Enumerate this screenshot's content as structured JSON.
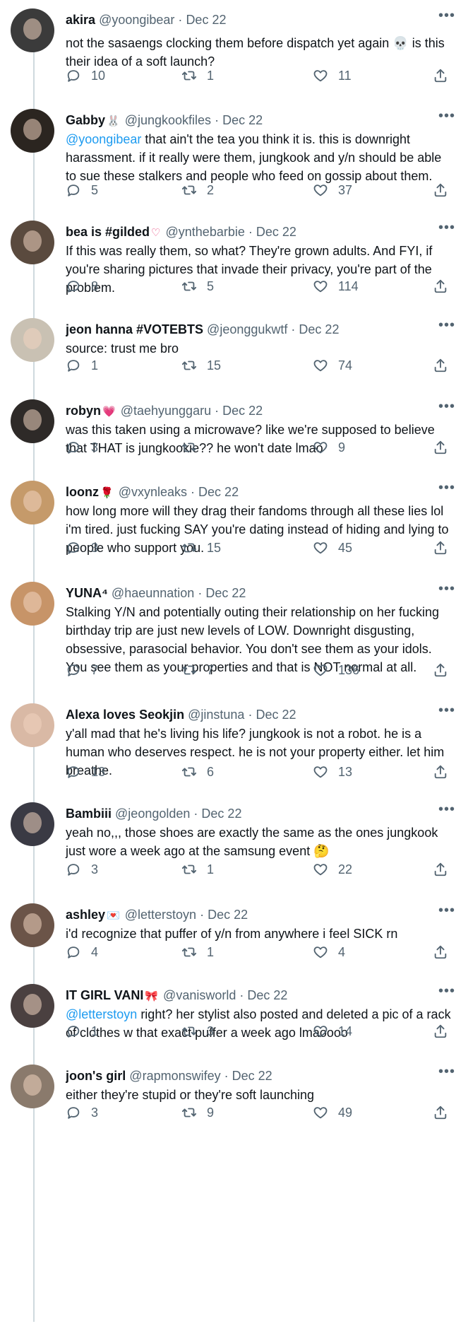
{
  "tweets": [
    {
      "name": "akira",
      "badge": "",
      "handle": "@yoongibear",
      "date": "Dec 22",
      "mention": "",
      "text": "not the sasaengs clocking them before dispatch yet again 💀 is this their idea of a soft launch?",
      "replies": "10",
      "retweets": "1",
      "likes": "11",
      "avatar_color": "#3b3b3b"
    },
    {
      "name": "Gabby",
      "badge": "🐰",
      "handle": "@jungkookfiles",
      "date": "Dec 22",
      "mention": "@yoongibear",
      "text": " that ain't the tea you think it is. this is downright harassment. if it really were them, jungkook and y/n should be able to sue these stalkers and people who feed on gossip about them.",
      "replies": "5",
      "retweets": "2",
      "likes": "37",
      "avatar_color": "#2b2520"
    },
    {
      "name": "bea is #gilded",
      "badge": "♡",
      "handle": "@ynthebarbie",
      "date": "Dec 22",
      "mention": "",
      "text": "If this was really them, so what? They're grown adults. And FYI, if you're sharing pictures that invade their privacy, you're part of the problem.",
      "replies": "8",
      "retweets": "5",
      "likes": "114",
      "avatar_color": "#5a4a3e"
    },
    {
      "name": "jeon hanna #VOTEBTS",
      "badge": "",
      "handle": "@jeonggukwtf",
      "date": "Dec 22",
      "mention": "",
      "text": "source: trust me bro",
      "replies": "1",
      "retweets": "15",
      "likes": "74",
      "avatar_color": "#c9c1b3"
    },
    {
      "name": "robyn",
      "badge": "💗",
      "handle": "@taehyunggaru",
      "date": "Dec 22",
      "mention": "",
      "text": "was this taken using a microwave? like we're supposed to believe that THAT is jungkookie?? he won't date lmao",
      "replies": "3",
      "retweets": "",
      "likes": "9",
      "avatar_color": "#2e2a28"
    },
    {
      "name": "loonz",
      "badge": "🌹",
      "handle": "@vxynleaks",
      "date": "Dec 22",
      "mention": "",
      "text": "how long more will they drag their fandoms through all these lies lol i'm tired. just fucking SAY you're dating instead of hiding and lying to people who support you.",
      "replies": "3",
      "retweets": "15",
      "likes": "45",
      "avatar_color": "#c59a6a"
    },
    {
      "name": "YUNA⁴",
      "badge": "",
      "handle": "@haeunnation",
      "date": "Dec 22",
      "mention": "",
      "text": "Stalking Y/N and potentially outing their relationship on her fucking birthday trip are just new levels of LOW. Downright disgusting, obsessive, parasocial behavior. You don't see them as your idols. You see them as your properties and that is NOT normal at all.",
      "replies": "7",
      "retweets": "7",
      "likes": "136",
      "avatar_color": "#c79468"
    },
    {
      "name": "Alexa loves Seokjin",
      "badge": "",
      "handle": "@jinstuna",
      "date": "Dec 22",
      "mention": "",
      "text": "y'all mad that he's living his life? jungkook is not a robot. he is a human who deserves respect. he is not your property either. let him breathe.",
      "replies": "13",
      "retweets": "6",
      "likes": "13",
      "avatar_color": "#d9b9a5"
    },
    {
      "name": "Bambiii",
      "badge": "",
      "handle": "@jeongolden",
      "date": "Dec 22",
      "mention": "",
      "text": "yeah no,,, those shoes are exactly the same as the ones jungkook just wore a week ago at the samsung event 🤔",
      "replies": "3",
      "retweets": "1",
      "likes": "22",
      "avatar_color": "#3a3a44"
    },
    {
      "name": "ashley",
      "badge": "💌",
      "handle": "@letterstoyn",
      "date": "Dec 22",
      "mention": "",
      "text": "i'd recognize that puffer of y/n from anywhere i feel SICK rn",
      "replies": "4",
      "retweets": "1",
      "likes": "4",
      "avatar_color": "#6b5448"
    },
    {
      "name": "IT GIRL VANI",
      "badge": "🎀",
      "handle": "@vanisworld",
      "date": "Dec 22",
      "mention": "@letterstoyn",
      "text": " right? her stylist also posted and deleted a pic of a rack of clothes w that exact puffer a week ago lmaoooo",
      "replies": "1",
      "retweets": "3",
      "likes": "14",
      "avatar_color": "#4a4040"
    },
    {
      "name": "joon's girl",
      "badge": "",
      "handle": "@rapmonswifey",
      "date": "Dec 22",
      "mention": "",
      "text": "either they're stupid or they're soft launching",
      "replies": "3",
      "retweets": "9",
      "likes": "49",
      "avatar_color": "#8a7a6c"
    }
  ],
  "ui": {
    "sep": "·",
    "more": "•••",
    "accent": "#1d9bf0",
    "muted": "#536471"
  }
}
